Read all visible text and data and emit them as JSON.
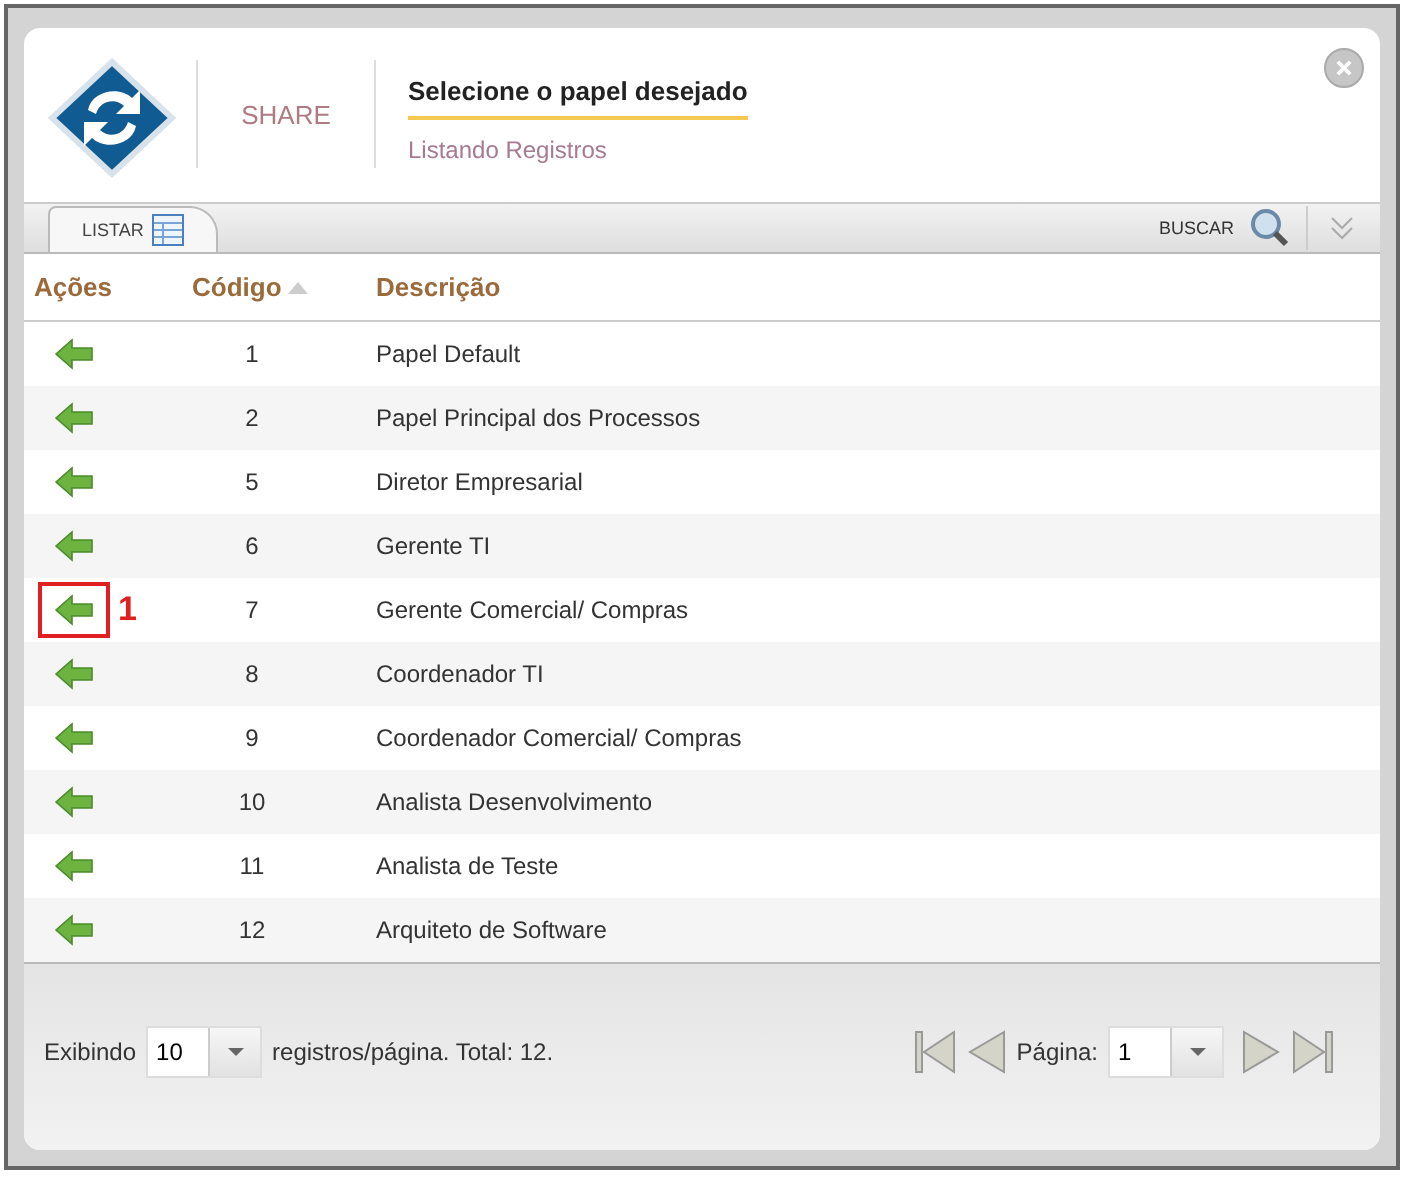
{
  "header": {
    "brand": "SHARE",
    "title": "Selecione o papel desejado",
    "subtitle": "Listando Registros"
  },
  "tabs": [
    {
      "label": "LISTAR",
      "selected": true
    }
  ],
  "search": {
    "label": "BUSCAR"
  },
  "table": {
    "columns": [
      {
        "label": "Ações",
        "sorted": false
      },
      {
        "label": "Código",
        "sorted": true
      },
      {
        "label": "Descrição",
        "sorted": false
      }
    ],
    "rows": [
      {
        "code": "1",
        "description": "Papel Default"
      },
      {
        "code": "2",
        "description": "Papel Principal dos Processos"
      },
      {
        "code": "5",
        "description": "Diretor Empresarial"
      },
      {
        "code": "6",
        "description": "Gerente TI"
      },
      {
        "code": "7",
        "description": "Gerente Comercial/ Compras",
        "callout": "1"
      },
      {
        "code": "8",
        "description": "Coordenador TI"
      },
      {
        "code": "9",
        "description": "Coordenador Comercial/ Compras"
      },
      {
        "code": "10",
        "description": "Analista Desenvolvimento"
      },
      {
        "code": "11",
        "description": "Analista de Teste"
      },
      {
        "code": "12",
        "description": "Arquiteto de Software"
      }
    ]
  },
  "footer": {
    "showing_label": "Exibindo",
    "page_size": "10",
    "summary": "registros/página. Total: 12.",
    "page_label": "Página:",
    "page": "1"
  }
}
